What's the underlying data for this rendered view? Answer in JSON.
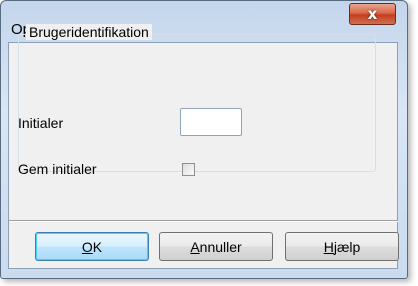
{
  "window": {
    "title": "Opstart",
    "close_glyph": "x"
  },
  "group": {
    "label": "Brugeridentifikation"
  },
  "fields": {
    "initialer_label": "Initialer",
    "initialer_value": "",
    "gem_label": "Gem initialer",
    "gem_checked": false
  },
  "buttons": {
    "ok": {
      "mnemonic": "O",
      "rest": "K"
    },
    "annuller": {
      "mnemonic": "A",
      "rest": "nnuller"
    },
    "hjaelp": {
      "mnemonic": "H",
      "rest": "jælp"
    }
  },
  "icons": {
    "close": "close-icon"
  }
}
